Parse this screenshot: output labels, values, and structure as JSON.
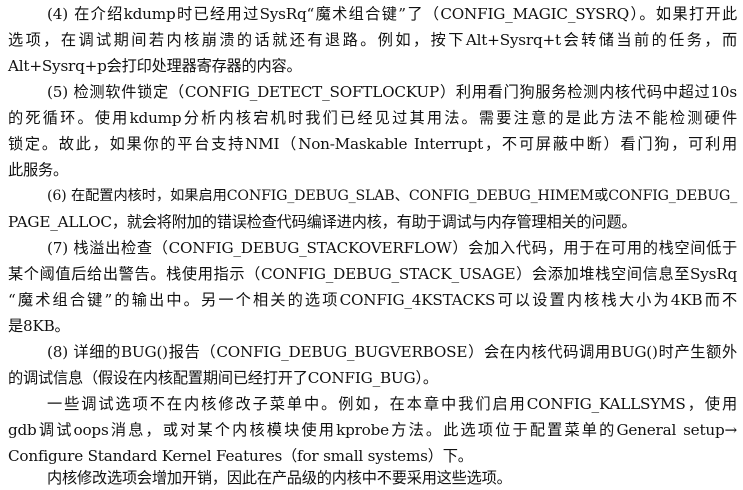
{
  "document": {
    "lines": [
      "(4) 在介绍kdump时已经用过SysRq“魔术组合键”了（CONFIG_MAGIC_SYSRQ）。如果打开此",
      "选项，在调试期间若内核崩溃的话就还有退路。例如，按下Alt+Sysrq+t会转储当前的任务，而",
      "Alt+Sysrq+p会打印处理器寄存器的内容。",
      "(5) 检测软件锁定（CONFIG_DETECT_SOFTLOCKUP）利用看门狗服务检测内核代码中超过10s",
      "的死循环。使用kdump分析内核宕机时我们已经见过其用法。需要注意的是此方法不能检测硬件",
      "锁定。故此，如果你的平台支持NMI（Non-Maskable Interrupt，不可屏蔽中断）看门狗，可利用",
      "此服务。",
      "(6) 在配置内核时，如果启用CONFIG_DEBUG_SLAB、CONFIG_DEBUG_HIMEM或CONFIG_DEBUG_",
      "PAGE_ALLOC，就会将附加的错误检查代码编译进内核，有助于调试与内存管理相关的问题。",
      "(7) 栈溢出检查（CONFIG_DEBUG_STACKOVERFLOW）会加入代码，用于在可用的栈空间低于",
      "某个阈值后给出警告。栈使用指示（CONFIG_DEBUG_STACK_USAGE）会添加堆栈空间信息至SysRq",
      "“魔术组合键”的输出中。另一个相关的选项CONFIG_4KSTACKS可以设置内核栈大小为4KB而不",
      "是8KB。",
      "(8) 详细的BUG()报告（CONFIG_DEBUG_BUGVERBOSE）会在内核代码调用BUG()时产生额外",
      "的调试信息（假设在内核配置期间已经打开了CONFIG_BUG）。",
      "一些调试选项不在内核修改子菜单中。例如，在本章中我们启用CONFIG_KALLSYMS，使用",
      "gdb调试oops消息，或对某个内核模块使用kprobe方法。此选项位于配置菜单的General setup→",
      "Configure Standard Kernel Features（for small systems）下。",
      "内核修改选项会增加开销，因此在产品级的内核中不要采用这些选项。"
    ]
  }
}
